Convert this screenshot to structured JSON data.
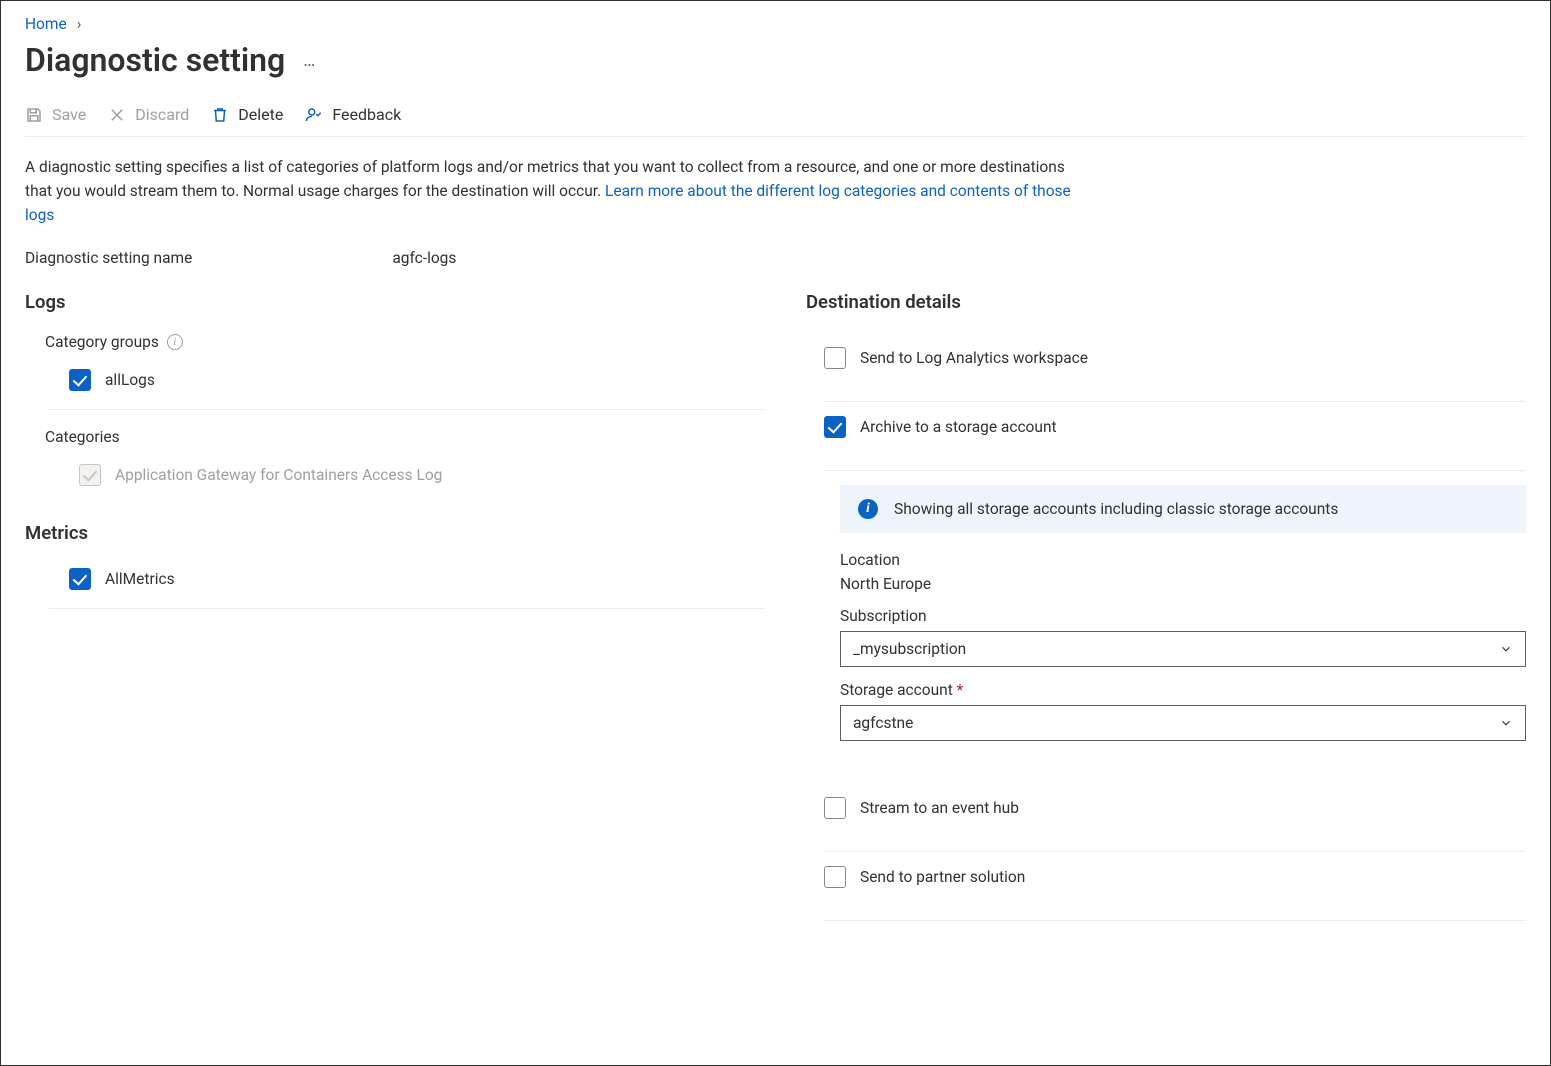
{
  "breadcrumb": {
    "home": "Home"
  },
  "page_title": "Diagnostic setting",
  "toolbar": {
    "save": "Save",
    "discard": "Discard",
    "delete": "Delete",
    "feedback": "Feedback"
  },
  "description": {
    "text": "A diagnostic setting specifies a list of categories of platform logs and/or metrics that you want to collect from a resource, and one or more destinations that you would stream them to. Normal usage charges for the destination will occur. ",
    "link": "Learn more about the different log categories and contents of those logs"
  },
  "setting_name": {
    "label": "Diagnostic setting name",
    "value": "agfc-logs"
  },
  "logs": {
    "heading": "Logs",
    "category_groups_label": "Category groups",
    "all_logs": "allLogs",
    "categories_label": "Categories",
    "cat1": "Application Gateway for Containers Access Log"
  },
  "metrics": {
    "heading": "Metrics",
    "all_metrics": "AllMetrics"
  },
  "dest": {
    "heading": "Destination details",
    "law": "Send to Log Analytics workspace",
    "storage": "Archive to a storage account",
    "info": "Showing all storage accounts including classic storage accounts",
    "location_label": "Location",
    "location_value": "North Europe",
    "subscription_label": "Subscription",
    "subscription_value": "_mysubscription",
    "storage_account_label": "Storage account",
    "storage_account_value": "agfcstne",
    "eventhub": "Stream to an event hub",
    "partner": "Send to partner solution"
  }
}
